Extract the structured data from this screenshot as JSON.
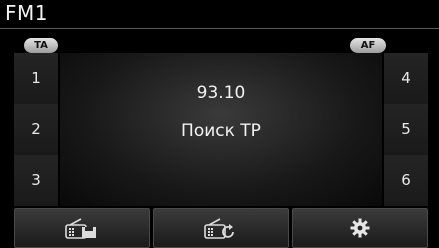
{
  "header": {
    "title": "FM1"
  },
  "toggles": {
    "ta_label": "TA",
    "af_label": "AF"
  },
  "presets": {
    "left": [
      "1",
      "2",
      "3"
    ],
    "right": [
      "4",
      "5",
      "6"
    ]
  },
  "station": {
    "frequency": "93.10",
    "status": "Поиск TP"
  },
  "bottom_bar": {
    "icons": [
      "radio-save-icon",
      "radio-seek-icon",
      "settings-gear-icon"
    ]
  }
}
